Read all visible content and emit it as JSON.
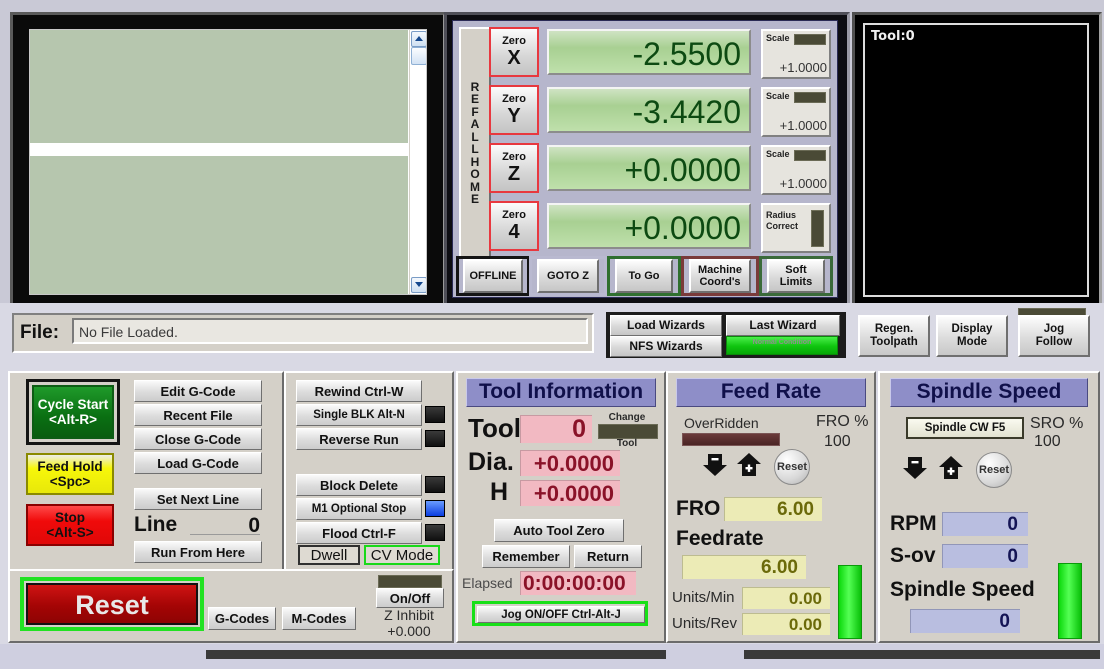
{
  "gcode_view": {
    "selected_line": ""
  },
  "dro": {
    "ref_all_home": [
      "R",
      "E",
      "F",
      "A",
      "L",
      "L",
      "H",
      "O",
      "M",
      "E"
    ],
    "axes": [
      {
        "zero_label": "Zero",
        "axis": "X",
        "value": "-2.5500",
        "scale_label": "Scale",
        "scale_value": "+1.0000"
      },
      {
        "zero_label": "Zero",
        "axis": "Y",
        "value": "-3.4420",
        "scale_label": "Scale",
        "scale_value": "+1.0000"
      },
      {
        "zero_label": "Zero",
        "axis": "Z",
        "value": "+0.0000",
        "scale_label": "Scale",
        "scale_value": "+1.0000"
      },
      {
        "zero_label": "Zero",
        "axis": "4",
        "value": "+0.0000",
        "radius_label_1": "Radius",
        "radius_label_2": "Correct"
      }
    ],
    "mode_buttons": [
      {
        "line1": "OFFLINE",
        "line2": ""
      },
      {
        "line1": "GOTO Z",
        "line2": ""
      },
      {
        "line1": "To Go",
        "line2": ""
      },
      {
        "line1": "Machine",
        "line2": "Coord's"
      },
      {
        "line1": "Soft",
        "line2": "Limits"
      }
    ]
  },
  "toolpath_window": {
    "tool_label": "Tool:0"
  },
  "file_bar": {
    "label": "File:",
    "value": "No File Loaded."
  },
  "wizards": {
    "load": "Load Wizards",
    "last": "Last Wizard",
    "nfs": "NFS Wizards",
    "status_led": "Normal Condition"
  },
  "right_buttons": [
    {
      "line1": "Regen.",
      "line2": "Toolpath"
    },
    {
      "line1": "Display",
      "line2": "Mode"
    },
    {
      "line1": "Jog",
      "line2": "Follow"
    }
  ],
  "control": {
    "cycle_start": {
      "line1": "Cycle Start",
      "line2": "<Alt-R>"
    },
    "feed_hold": {
      "line1": "Feed Hold",
      "line2": "<Spc>"
    },
    "stop": {
      "line1": "Stop",
      "line2": "<Alt-S>"
    },
    "reset": "Reset",
    "file_buttons": [
      "Edit G-Code",
      "Recent File",
      "Close G-Code",
      "Load G-Code"
    ],
    "set_next_line": "Set Next Line",
    "line_label": "Line",
    "line_value": "0",
    "run_from_here": "Run From Here",
    "gcodes": "G-Codes",
    "mcodes": "M-Codes",
    "run_buttons": [
      "Rewind Ctrl-W",
      "Single BLK Alt-N",
      "Reverse Run"
    ],
    "opt_buttons": [
      "Block Delete",
      "M1 Optional Stop",
      "Flood Ctrl-F"
    ],
    "dwell": "Dwell",
    "cv_mode": "CV Mode",
    "on_off": "On/Off",
    "z_inhibit_label": "Z Inhibit",
    "z_inhibit_value": "+0.000"
  },
  "tool_information": {
    "title": "Tool Information",
    "tool_label": "Tool",
    "tool_value": "0",
    "change_label_1": "Change",
    "change_label_2": "Tool",
    "dia_label": "Dia.",
    "dia_value": "+0.0000",
    "h_label": "H",
    "h_value": "+0.0000",
    "auto_tool_zero": "Auto Tool Zero",
    "remember": "Remember",
    "return": "Return",
    "elapsed_label": "Elapsed",
    "elapsed_value": "0:00:00:00",
    "jog_toggle": "Jog ON/OFF Ctrl-Alt-J"
  },
  "feed_rate": {
    "title": "Feed Rate",
    "overridden_label": "OverRidden",
    "fro_pct_label": "FRO %",
    "fro_pct_value": "100",
    "reset_label": "Reset",
    "fro_label": "FRO",
    "fro_value": "6.00",
    "feedrate_label": "Feedrate",
    "feedrate_value": "6.00",
    "units_min_label": "Units/Min",
    "units_min_value": "0.00",
    "units_rev_label": "Units/Rev",
    "units_rev_value": "0.00"
  },
  "spindle_speed": {
    "title": "Spindle Speed",
    "spindle_cw": "Spindle CW F5",
    "sro_pct_label": "SRO %",
    "sro_pct_value": "100",
    "reset_label": "Reset",
    "rpm_label": "RPM",
    "rpm_value": "0",
    "sov_label": "S-ov",
    "sov_value": "0",
    "speed_label": "Spindle Speed",
    "speed_value": "0"
  },
  "colors": {
    "accent_title": "#8e8ec8",
    "dro_green": "#a8d092",
    "cycle_start": "#0a7a14",
    "feed_hold": "#f2f20a",
    "stop": "#f20a0a",
    "reset": "#b00000",
    "led_green": "#0fc40f"
  }
}
